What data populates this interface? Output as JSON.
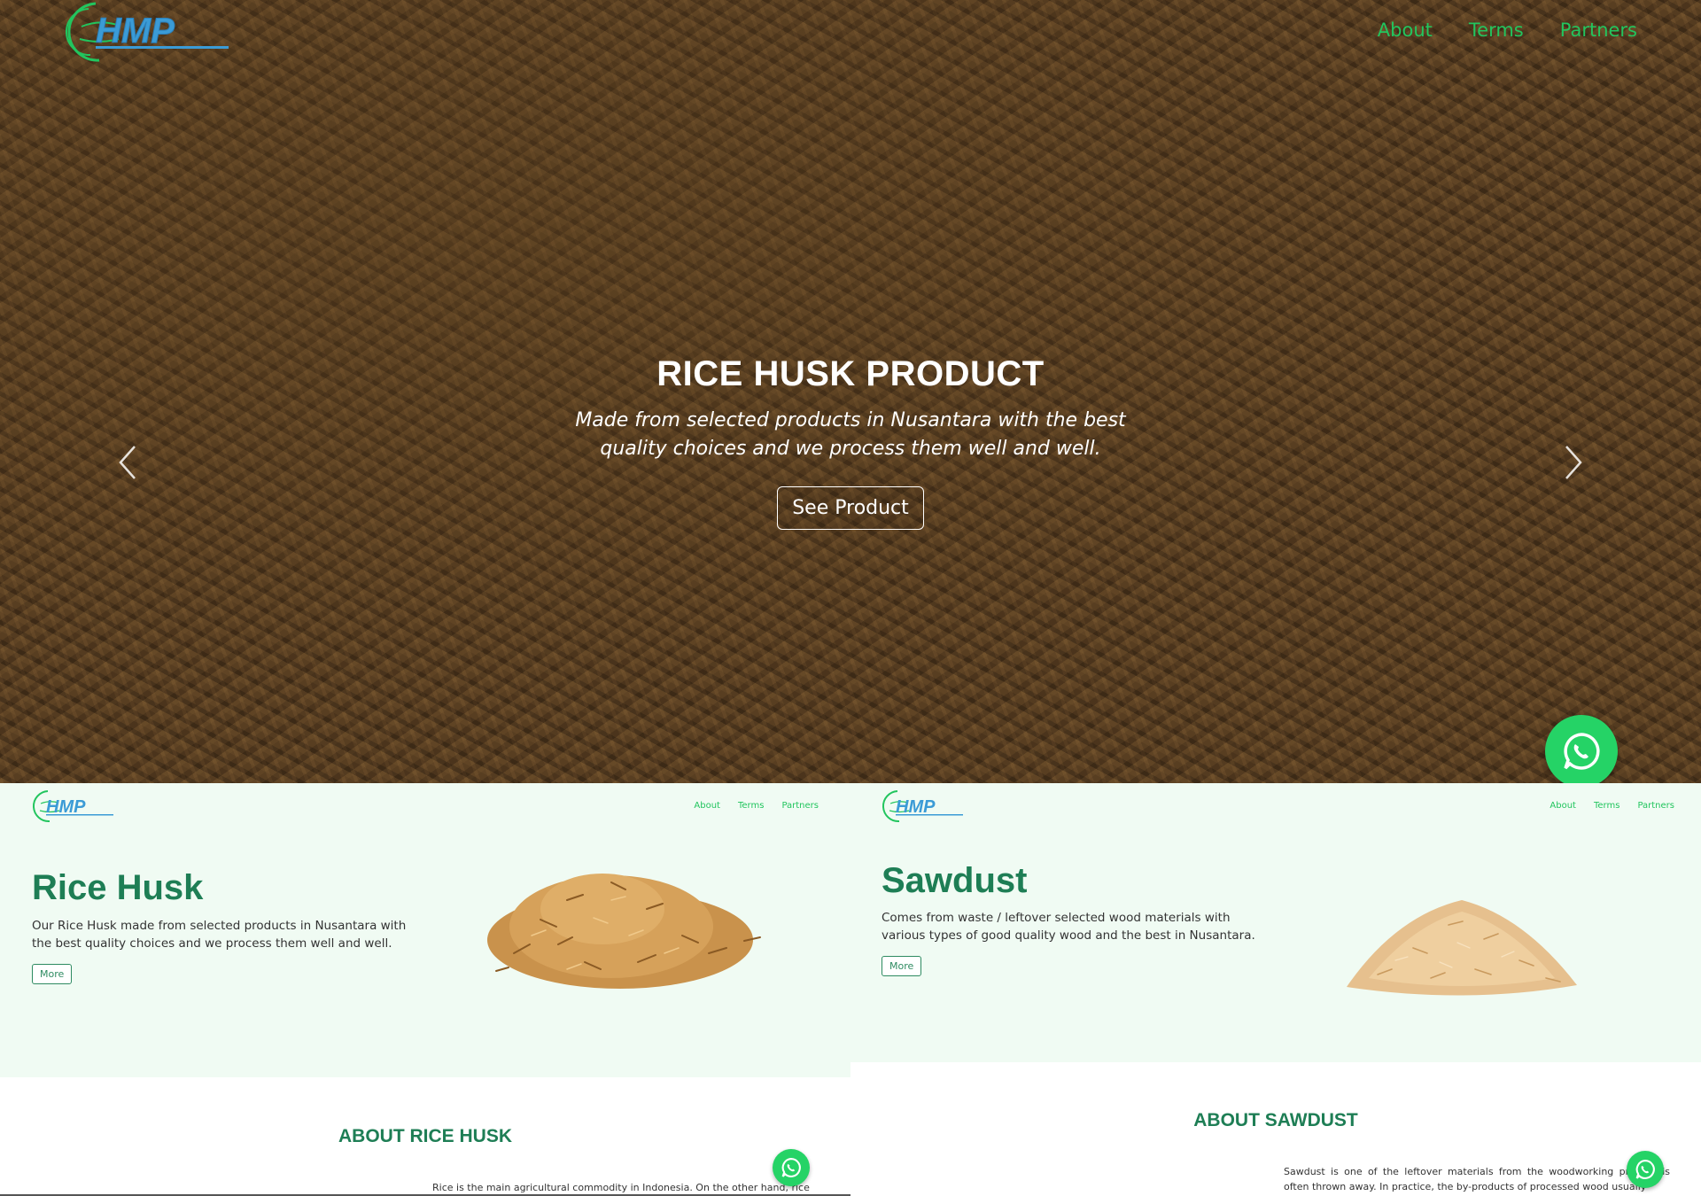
{
  "brand": {
    "logo_text": "HMP",
    "accent_color": "#22c55e",
    "title_color": "#1e7e55"
  },
  "nav": {
    "about": "About",
    "terms": "Terms",
    "partners": "Partners"
  },
  "hero": {
    "title": "RICE HUSK PRODUCT",
    "subtitle": "Made from selected products in Nusantara with the best quality choices and we process them well and well.",
    "button": "See Product"
  },
  "rice_husk": {
    "title": "Rice Husk",
    "description": "Our Rice Husk made from selected products in Nusantara with the best quality choices and we process them well and well.",
    "more": "More",
    "about_title": "ABOUT RICE HUSK",
    "about_text": "Rice is the main agricultural commodity in Indonesia. On the other hand, rice"
  },
  "sawdust": {
    "title": "Sawdust",
    "description": "Comes from waste / leftover selected wood materials with various types of good quality wood and the best in Nusantara.",
    "more": "More",
    "about_title": "ABOUT SAWDUST",
    "about_text": "Sawdust is one of the leftover materials from the woodworking process is often thrown away. In practice, the by-products of processed wood usually"
  },
  "icons": {
    "prev": "chevron-left-icon",
    "next": "chevron-right-icon",
    "whatsapp": "whatsapp-icon"
  }
}
